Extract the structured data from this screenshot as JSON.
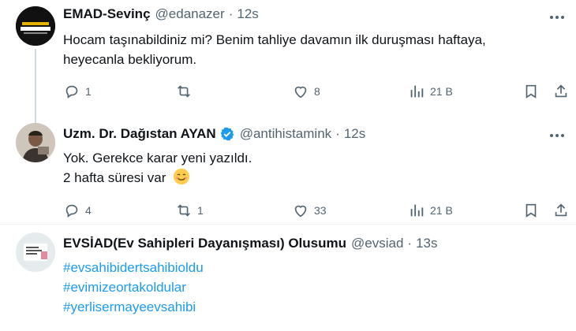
{
  "tweets": [
    {
      "name": "EMAD-Sevinç",
      "handle": "@edanazer",
      "time": "12s",
      "avatar_text": "",
      "lines": [
        "Hocam taşınabildiniz mi? Benim tahliye davamın ilk duruşması haftaya,",
        "heyecanla bekliyorum."
      ],
      "replies": "1",
      "retweets": "",
      "likes": "8",
      "views": "21 B"
    },
    {
      "name": "Uzm. Dr. Dağıstan AYAN",
      "handle": "@antihistamink",
      "time": "12s",
      "verified": true,
      "lines": [
        "Yok. Gerekce karar yeni yazıldı.",
        "2 hafta süresi var"
      ],
      "emoji": "smiling-face-emoji",
      "replies": "4",
      "retweets": "1",
      "likes": "33",
      "views": "21 B"
    },
    {
      "name": "EVSİAD(Ev Sahipleri Dayanışması) Olusumu",
      "handle": "@evsiad",
      "time": "13s",
      "hashtags": [
        "#evsahibidertsahibioldu",
        "#evimizeortakoldular",
        "#yerlisermayeevsahibi"
      ]
    }
  ],
  "dot": "·",
  "colors": {
    "accent": "#1d9bf0",
    "muted": "#536471",
    "text": "#0f1419",
    "divider": "#eff3f4"
  }
}
